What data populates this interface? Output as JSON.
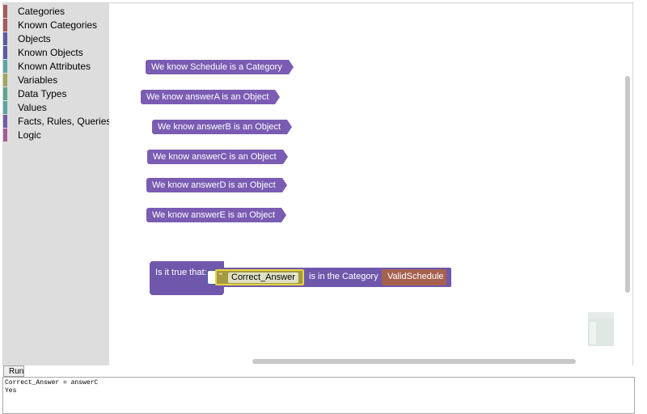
{
  "toolbox": {
    "categories": [
      {
        "label": "Categories",
        "color": "#a55b5b"
      },
      {
        "label": "Known Categories",
        "color": "#a55b5b"
      },
      {
        "label": "Objects",
        "color": "#5b5ba5"
      },
      {
        "label": "Known Objects",
        "color": "#5b5ba5"
      },
      {
        "label": "Known Attributes",
        "color": "#5ba5a5"
      },
      {
        "label": "Variables",
        "color": "#a5a55b"
      },
      {
        "label": "Data Types",
        "color": "#5ba58c"
      },
      {
        "label": "Values",
        "color": "#5ba5a5"
      },
      {
        "label": "Facts, Rules, Queries",
        "color": "#745ba5"
      },
      {
        "label": "Logic",
        "color": "#a55b99"
      }
    ]
  },
  "workspace": {
    "fact_blocks": [
      {
        "text": "We know Schedule is a Category"
      },
      {
        "text": "We know answerA is an Object"
      },
      {
        "text": "We know answerB is an Object"
      },
      {
        "text": "We know answerC is an Object"
      },
      {
        "text": "We know answerD is an Object"
      },
      {
        "text": "We know answerE is an Object"
      }
    ],
    "query": {
      "prefix": "Is it true that:",
      "quote_open": "\"",
      "variable": "Correct_Answer",
      "quote_close": "\"",
      "relation": "is in the Category",
      "category": "ValidSchedule"
    },
    "block_color": "#7a5cb3"
  },
  "run_label": "Run",
  "output_text": "Correct_Answer = answerC\nYes"
}
